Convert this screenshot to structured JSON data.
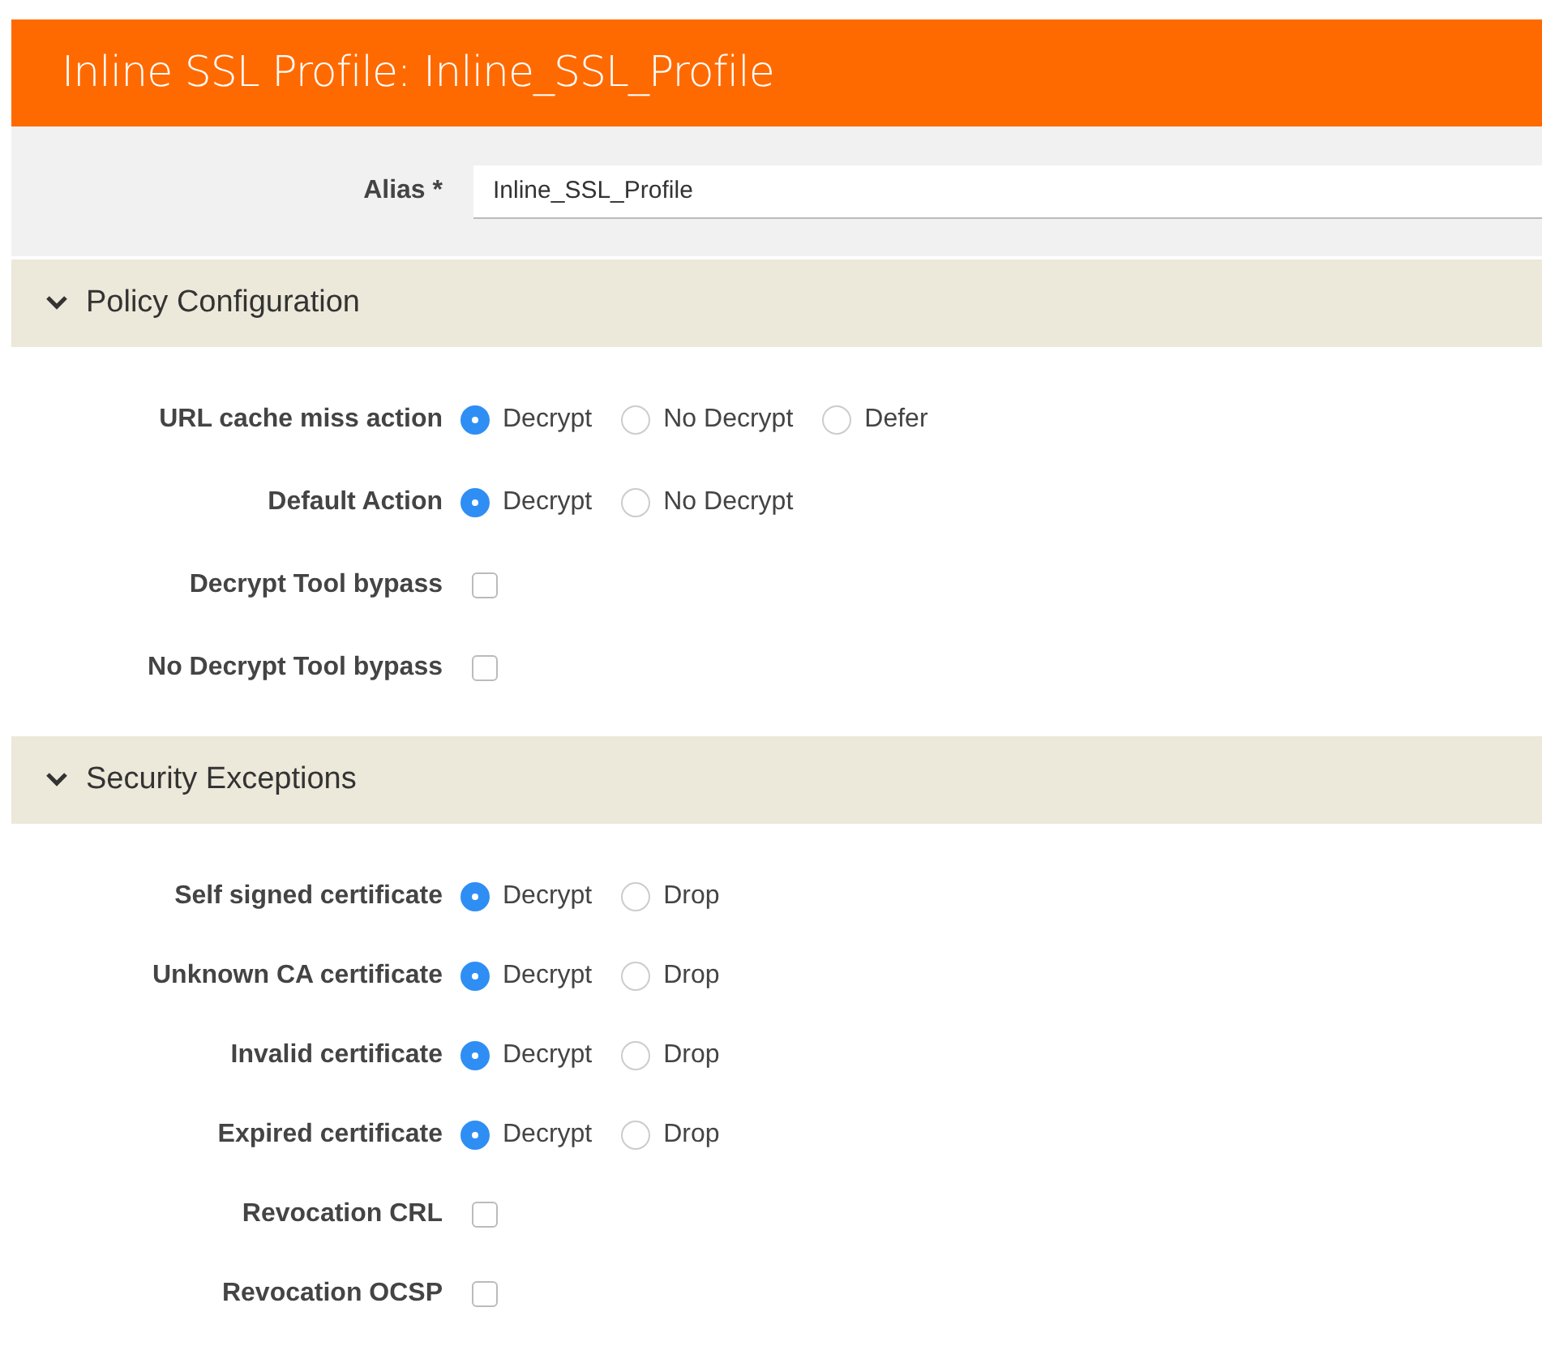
{
  "header": {
    "title": "Inline SSL Profile: Inline_SSL_Profile"
  },
  "alias": {
    "label": "Alias *",
    "value": "Inline_SSL_Profile"
  },
  "sections": [
    {
      "title": "Policy Configuration",
      "expanded": true,
      "fields": [
        {
          "kind": "radio",
          "label": "URL cache miss action",
          "options": [
            {
              "label": "Decrypt",
              "selected": true
            },
            {
              "label": "No Decrypt",
              "selected": false
            },
            {
              "label": "Defer",
              "selected": false
            }
          ]
        },
        {
          "kind": "radio",
          "label": "Default Action",
          "options": [
            {
              "label": "Decrypt",
              "selected": true
            },
            {
              "label": "No Decrypt",
              "selected": false
            }
          ]
        },
        {
          "kind": "checkbox",
          "label": "Decrypt Tool bypass",
          "checked": false
        },
        {
          "kind": "checkbox",
          "label": "No Decrypt Tool bypass",
          "checked": false
        }
      ]
    },
    {
      "title": "Security Exceptions",
      "expanded": true,
      "fields": [
        {
          "kind": "radio",
          "label": "Self signed certificate",
          "options": [
            {
              "label": "Decrypt",
              "selected": true
            },
            {
              "label": "Drop",
              "selected": false
            }
          ]
        },
        {
          "kind": "radio",
          "label": "Unknown CA certificate",
          "options": [
            {
              "label": "Decrypt",
              "selected": true
            },
            {
              "label": "Drop",
              "selected": false
            }
          ]
        },
        {
          "kind": "radio",
          "label": "Invalid certificate",
          "options": [
            {
              "label": "Decrypt",
              "selected": true
            },
            {
              "label": "Drop",
              "selected": false
            }
          ]
        },
        {
          "kind": "radio",
          "label": "Expired certificate",
          "options": [
            {
              "label": "Decrypt",
              "selected": true
            },
            {
              "label": "Drop",
              "selected": false
            }
          ]
        },
        {
          "kind": "checkbox",
          "label": "Revocation CRL",
          "checked": false
        },
        {
          "kind": "checkbox",
          "label": "Revocation OCSP",
          "checked": false
        }
      ]
    }
  ]
}
